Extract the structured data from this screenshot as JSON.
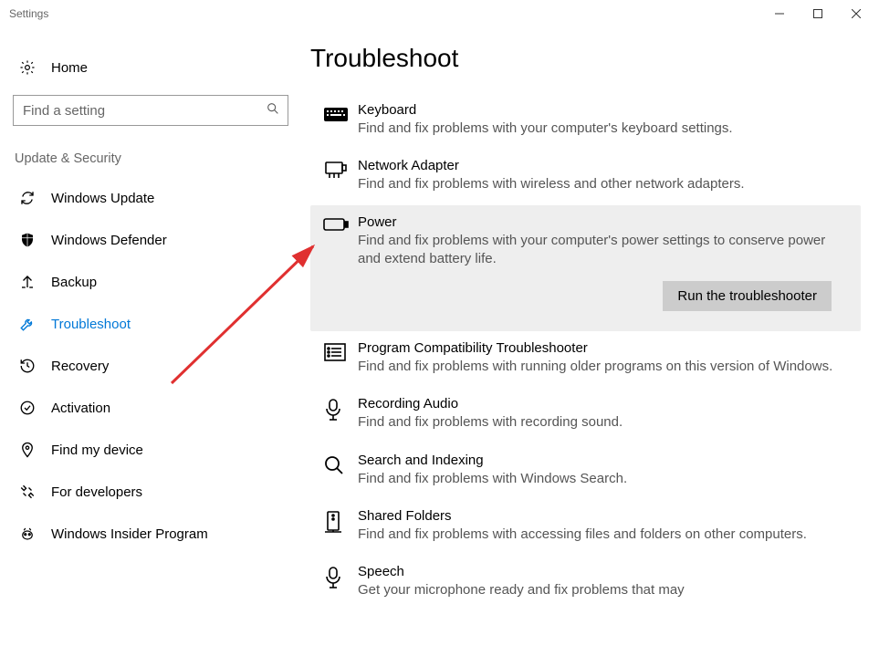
{
  "window": {
    "title": "Settings"
  },
  "home": {
    "label": "Home"
  },
  "search": {
    "placeholder": "Find a setting"
  },
  "category": {
    "label": "Update & Security"
  },
  "nav": {
    "items": [
      {
        "label": "Windows Update"
      },
      {
        "label": "Windows Defender"
      },
      {
        "label": "Backup"
      },
      {
        "label": "Troubleshoot"
      },
      {
        "label": "Recovery"
      },
      {
        "label": "Activation"
      },
      {
        "label": "Find my device"
      },
      {
        "label": "For developers"
      },
      {
        "label": "Windows Insider Program"
      }
    ]
  },
  "page": {
    "heading": "Troubleshoot"
  },
  "troubleshoot": {
    "run_label": "Run the troubleshooter",
    "items": [
      {
        "title": "Keyboard",
        "desc": "Find and fix problems with your computer's keyboard settings."
      },
      {
        "title": "Network Adapter",
        "desc": "Find and fix problems with wireless and other network adapters."
      },
      {
        "title": "Power",
        "desc": "Find and fix problems with your computer's power settings to conserve power and extend battery life."
      },
      {
        "title": "Program Compatibility Troubleshooter",
        "desc": "Find and fix problems with running older programs on this version of Windows."
      },
      {
        "title": "Recording Audio",
        "desc": "Find and fix problems with recording sound."
      },
      {
        "title": "Search and Indexing",
        "desc": "Find and fix problems with Windows Search."
      },
      {
        "title": "Shared Folders",
        "desc": "Find and fix problems with accessing files and folders on other computers."
      },
      {
        "title": "Speech",
        "desc": "Get your microphone ready and fix problems that may"
      }
    ]
  }
}
